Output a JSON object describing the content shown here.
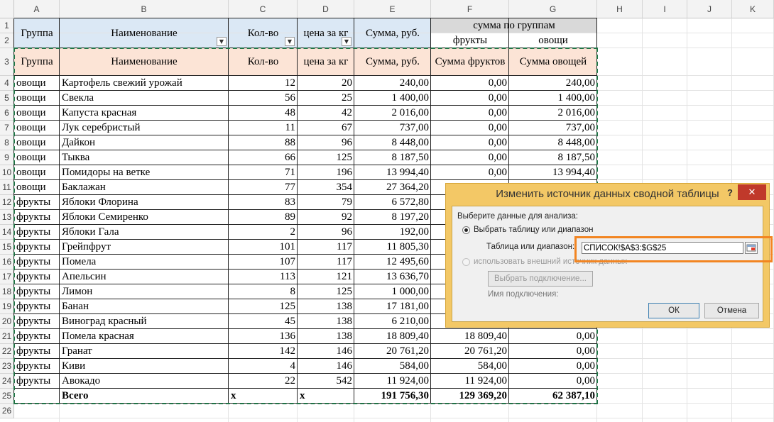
{
  "columns": [
    "A",
    "B",
    "C",
    "D",
    "E",
    "F",
    "G",
    "H",
    "I",
    "J",
    "K"
  ],
  "rows": [
    "1",
    "2",
    "3",
    "4",
    "5",
    "6",
    "7",
    "8",
    "9",
    "10",
    "11",
    "12",
    "13",
    "14",
    "15",
    "16",
    "17",
    "18",
    "19",
    "20",
    "21",
    "22",
    "23",
    "24",
    "25",
    "26"
  ],
  "header_top": {
    "group": "Группа",
    "name": "Наименование",
    "qty": "Кол-во",
    "price": "цена за кг",
    "sum": "Сумма, руб.",
    "groupsum": "сумма по группам",
    "fruits": "фрукты",
    "veg": "овощи"
  },
  "header_row3": [
    "Группа",
    "Наименование",
    "Кол-во",
    "цена за кг",
    "Сумма, руб.",
    "Сумма фруктов",
    "Сумма овощей"
  ],
  "data_rows": [
    [
      "овощи",
      "Картофель свежий урожай",
      "12",
      "20",
      "240,00",
      "0,00",
      "240,00"
    ],
    [
      "овощи",
      "Свекла",
      "56",
      "25",
      "1 400,00",
      "0,00",
      "1 400,00"
    ],
    [
      "овощи",
      "Капуста красная",
      "48",
      "42",
      "2 016,00",
      "0,00",
      "2 016,00"
    ],
    [
      "овощи",
      "Лук серебристый",
      "11",
      "67",
      "737,00",
      "0,00",
      "737,00"
    ],
    [
      "овощи",
      "Дайкон",
      "88",
      "96",
      "8 448,00",
      "0,00",
      "8 448,00"
    ],
    [
      "овощи",
      "Тыква",
      "66",
      "125",
      "8 187,50",
      "0,00",
      "8 187,50"
    ],
    [
      "овощи",
      "Помидоры на ветке",
      "71",
      "196",
      "13 994,40",
      "0,00",
      "13 994,40"
    ],
    [
      "овощи",
      "Баклажан",
      "77",
      "354",
      "27 364,20",
      "",
      ""
    ],
    [
      "фрукты",
      "Яблоки Флорина",
      "83",
      "79",
      "6 572,80",
      "",
      ""
    ],
    [
      "фрукты",
      "Яблоки Семиренко",
      "89",
      "92",
      "8 197,20",
      "",
      ""
    ],
    [
      "фрукты",
      "Яблоки Гала",
      "2",
      "96",
      "192,00",
      "",
      ""
    ],
    [
      "фрукты",
      "Грейпфрут",
      "101",
      "117",
      "11 805,30",
      "",
      ""
    ],
    [
      "фрукты",
      "Помела",
      "107",
      "117",
      "12 495,60",
      "",
      ""
    ],
    [
      "фрукты",
      "Апельсин",
      "113",
      "121",
      "13 636,70",
      "",
      ""
    ],
    [
      "фрукты",
      "Лимон",
      "8",
      "125",
      "1 000,00",
      "",
      ""
    ],
    [
      "фрукты",
      "Банан",
      "125",
      "138",
      "17 181,00",
      "",
      ""
    ],
    [
      "фрукты",
      "Виноград  красный",
      "45",
      "138",
      "6 210,00",
      "",
      ""
    ],
    [
      "фрукты",
      "Помела красная",
      "136",
      "138",
      "18 809,40",
      "18 809,40",
      "0,00"
    ],
    [
      "фрукты",
      "Гранат",
      "142",
      "146",
      "20 761,20",
      "20 761,20",
      "0,00"
    ],
    [
      "фрукты",
      "Киви",
      "4",
      "146",
      "584,00",
      "584,00",
      "0,00"
    ],
    [
      "фрукты",
      "Авокадо",
      "22",
      "542",
      "11 924,00",
      "11 924,00",
      "0,00"
    ]
  ],
  "total_row": [
    "",
    "Всего",
    "x",
    "x",
    "191 756,30",
    "129 369,20",
    "62 387,10"
  ],
  "dialog": {
    "title": "Изменить источник данных сводной таблицы",
    "help": "?",
    "close": "✕",
    "section_label": "Выберите данные для анализа:",
    "radio1": "Выбрать таблицу или диапазон",
    "range_label": "Таблица или диапазон:",
    "range_value": "СПИСОК!$A$3:$G$25",
    "radio2": "использовать внешний источник данных",
    "choose_conn": "Выбрать подключение...",
    "conn_name": "Имя подключения:",
    "ok": "ОК",
    "cancel": "Отмена"
  },
  "colors": {
    "header_blue": "#dbe8f5",
    "header_peach": "#fce4d6",
    "dialog_frame": "#f3c866",
    "highlight": "#f28522",
    "marching_ants": "#217346"
  },
  "icons": [
    "dropdown-arrow-icon",
    "range-selector-icon",
    "close-icon",
    "help-icon"
  ]
}
